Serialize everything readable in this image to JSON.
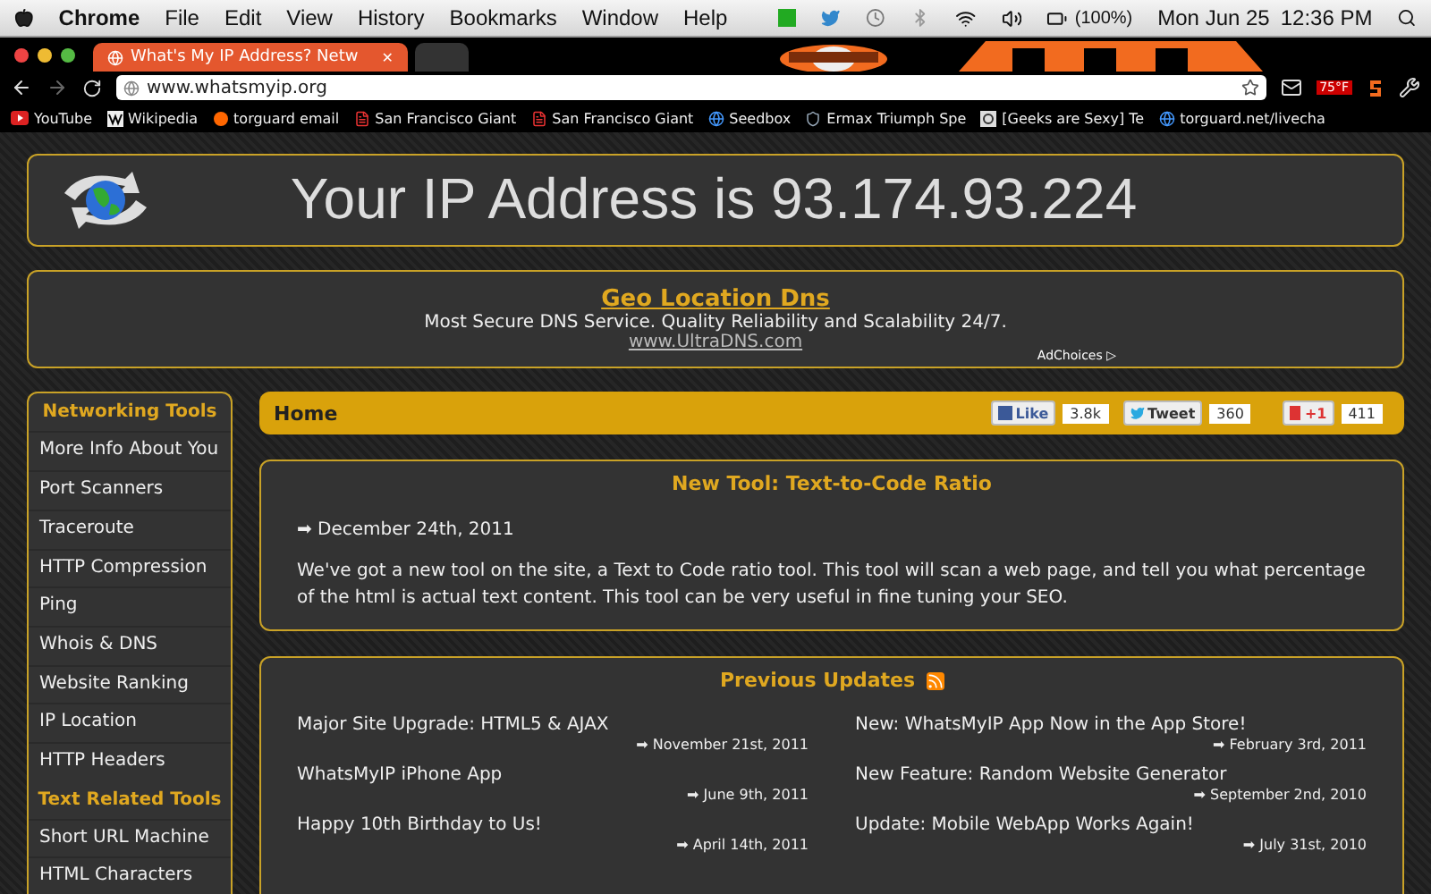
{
  "menubar": {
    "app": "Chrome",
    "menus": [
      "File",
      "Edit",
      "View",
      "History",
      "Bookmarks",
      "Window",
      "Help"
    ],
    "battery": "(100%)",
    "date": "Mon Jun 25",
    "time": "12:36 PM"
  },
  "browser": {
    "tabs": [
      {
        "title": "What's My IP Address? Netw",
        "close": "✕",
        "selected": true
      },
      {
        "selected": false
      }
    ],
    "url": "www.whatsmyip.org",
    "weather": "75°F",
    "bookmarks": [
      {
        "label": "YouTube",
        "kind": "youtube"
      },
      {
        "label": "Wikipedia",
        "kind": "wiki"
      },
      {
        "label": "torguard email",
        "kind": "cpanel"
      },
      {
        "label": "San Francisco Giant",
        "kind": "page"
      },
      {
        "label": "San Francisco Giant",
        "kind": "page"
      },
      {
        "label": "Seedbox",
        "kind": "globe"
      },
      {
        "label": "Ermax Triumph Spe",
        "kind": "shield"
      },
      {
        "label": "[Geeks are Sexy] Te",
        "kind": "g"
      },
      {
        "label": "torguard.net/livecha",
        "kind": "globe"
      }
    ]
  },
  "header": {
    "ip_text": "Your IP Address is 93.174.93.224"
  },
  "ad": {
    "title": "Geo Location Dns",
    "text": "Most Secure DNS Service. Quality Reliability and Scalability 24/7.",
    "url": "www.UltraDNS.com",
    "adchoices": "AdChoices",
    "adchoices_mark": "▷"
  },
  "sidebar": [
    {
      "heading": "Networking Tools",
      "items": [
        "More Info About You",
        "Port Scanners",
        "Traceroute",
        "HTTP Compression",
        "Ping",
        "Whois & DNS",
        "Website Ranking",
        "IP Location",
        "HTTP Headers"
      ]
    },
    {
      "heading": "Text Related Tools",
      "items": [
        "Short URL Machine",
        "HTML Characters"
      ]
    }
  ],
  "home_bar": {
    "title": "Home",
    "social": [
      {
        "kind": "facebook",
        "label": "Like",
        "count": "3.8k"
      },
      {
        "kind": "twitter",
        "label": "Tweet",
        "count": "360"
      },
      {
        "kind": "google",
        "label": "+1",
        "count": "411"
      }
    ]
  },
  "news": {
    "title": "New Tool: Text-to-Code Ratio",
    "date": "➡ December 24th, 2011",
    "body": "We've got a new tool on the site, a Text to Code ratio tool. This tool will scan a web page, and tell you what percentage of the html is actual text content. This tool can be very useful in fine tuning your SEO."
  },
  "updates": {
    "title": "Previous Updates",
    "items": [
      {
        "title": "Major Site Upgrade: HTML5 & AJAX",
        "date": "➡ November 21st, 2011"
      },
      {
        "title": "New: WhatsMyIP App Now in the App Store!",
        "date": "➡ February 3rd, 2011"
      },
      {
        "title": "WhatsMyIP iPhone App",
        "date": "➡ June 9th, 2011"
      },
      {
        "title": "New Feature: Random Website Generator",
        "date": "➡ September 2nd, 2010"
      },
      {
        "title": "Happy 10th Birthday to Us!",
        "date": "➡ April 14th, 2011"
      },
      {
        "title": "Update: Mobile WebApp Works Again!",
        "date": "➡ July 31st, 2010"
      }
    ]
  }
}
